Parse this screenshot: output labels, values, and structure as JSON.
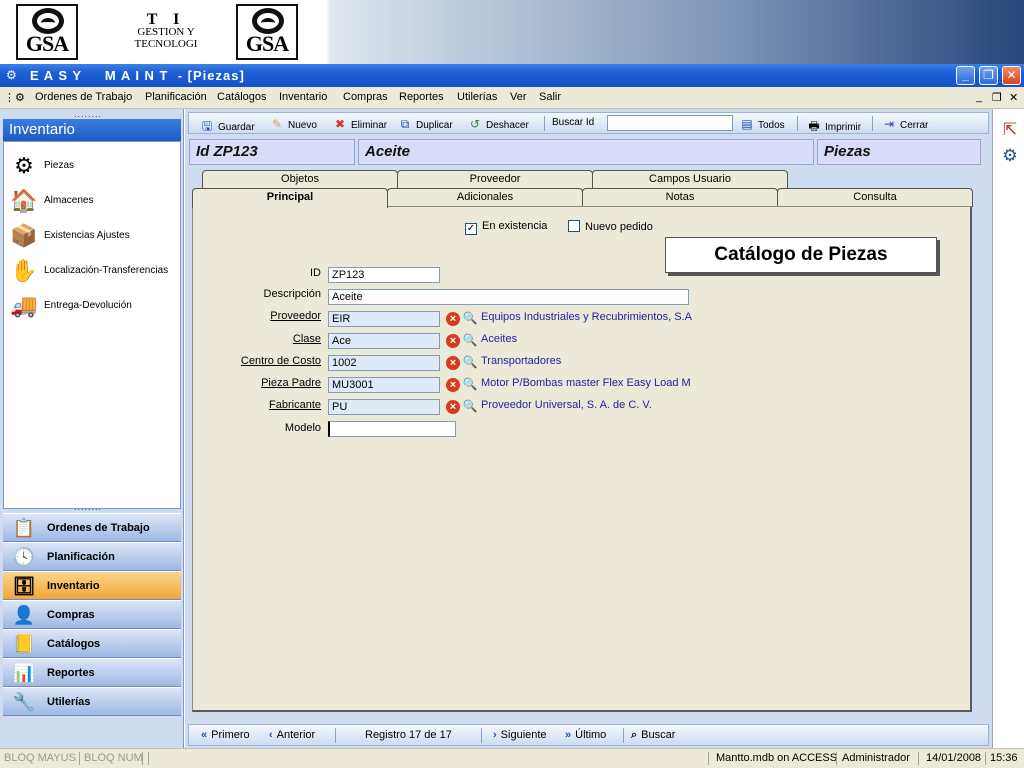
{
  "banner": {
    "logo_left": "GSA",
    "ti_big": "T I",
    "ti_line1": "GESTION Y",
    "ti_line2": "TECNOLOGI",
    "logo_right": "GSA"
  },
  "window": {
    "title": "E A S Y     M A I N T  - [Piezas]",
    "minimize": "_",
    "restore": "❐",
    "close": "✕"
  },
  "menu": {
    "items": [
      "Ordenes de Trabajo",
      "Planificación",
      "Catálogos",
      "Inventario",
      "Compras",
      "Reportes",
      "Utilerías",
      "Ver",
      "Salir"
    ],
    "min": "_",
    "restore": "❐",
    "close": "✕"
  },
  "left": {
    "header": "Inventario",
    "items": [
      {
        "label": "Piezas",
        "icon": "gears-icon"
      },
      {
        "label": "Almacenes",
        "icon": "warehouse-icon"
      },
      {
        "label": "Existencias Ajustes",
        "icon": "boxes-icon"
      },
      {
        "label": "Localización-Transferencias",
        "icon": "transfer-icon"
      },
      {
        "label": "Entrega-Devolución",
        "icon": "delivery-icon"
      }
    ],
    "dots": "........",
    "nav": [
      {
        "label": "Ordenes de Trabajo",
        "icon": "work-order-icon"
      },
      {
        "label": "Planificación",
        "icon": "clock-icon"
      },
      {
        "label": "Inventario",
        "icon": "inventory-icon"
      },
      {
        "label": "Compras",
        "icon": "purchases-icon"
      },
      {
        "label": "Catálogos",
        "icon": "book-icon"
      },
      {
        "label": "Reportes",
        "icon": "chart-icon"
      },
      {
        "label": "Utilerías",
        "icon": "tools-icon"
      }
    ],
    "active_nav": "Inventario"
  },
  "toolbar": {
    "guardar": "Guardar",
    "nuevo": "Nuevo",
    "eliminar": "Eliminar",
    "duplicar": "Duplicar",
    "deshacer": "Deshacer",
    "buscar_id": "Buscar Id",
    "todos": "Todos",
    "imprimir": "Imprimir",
    "cerrar": "Cerrar"
  },
  "header": {
    "id": "Id  ZP123",
    "name": "Aceite",
    "type": "Piezas"
  },
  "tabs": {
    "back": [
      "Objetos",
      "Proveedor",
      "Campos Usuario"
    ],
    "front": [
      "Principal",
      "Adicionales",
      "Notas",
      "Consulta"
    ],
    "active": "Principal"
  },
  "form": {
    "catalog_title": "Catálogo de Piezas",
    "en_existencia": "En existencia",
    "en_existencia_checked": "✓",
    "nuevo_pedido": "Nuevo pedido",
    "fields": {
      "id": {
        "label": "ID",
        "value": "ZP123"
      },
      "descripcion": {
        "label": "Descripción",
        "value": "Aceite"
      },
      "proveedor": {
        "label": "Proveedor",
        "value": "EIR",
        "desc": "Equipos Industriales y Recubrimientos, S.A"
      },
      "clase": {
        "label": "Clase",
        "value": "Ace",
        "desc": "Aceites"
      },
      "centro_costo": {
        "label": "Centro de Costo",
        "value": "1002",
        "desc": "Transportadores"
      },
      "pieza_padre": {
        "label": "Pieza Padre",
        "value": "MU3001",
        "desc": "Motor P/Bombas master Flex Easy Load M"
      },
      "fabricante": {
        "label": "Fabricante",
        "value": "PU",
        "desc": "Proveedor Universal, S. A. de C. V."
      },
      "modelo": {
        "label": "Modelo",
        "value": ""
      }
    }
  },
  "navbar": {
    "primero": "Primero",
    "anterior": "Anterior",
    "registro": "Registro 17 de 17",
    "siguiente": "Siguiente",
    "ultimo": "Último",
    "buscar": "Buscar"
  },
  "status": {
    "mayus": "BLOQ MAYUS",
    "num": "BLOQ NUM",
    "db": "Mantto.mdb on ACCESS",
    "user": "Administrador",
    "date": "14/01/2008",
    "time": "15:36"
  }
}
